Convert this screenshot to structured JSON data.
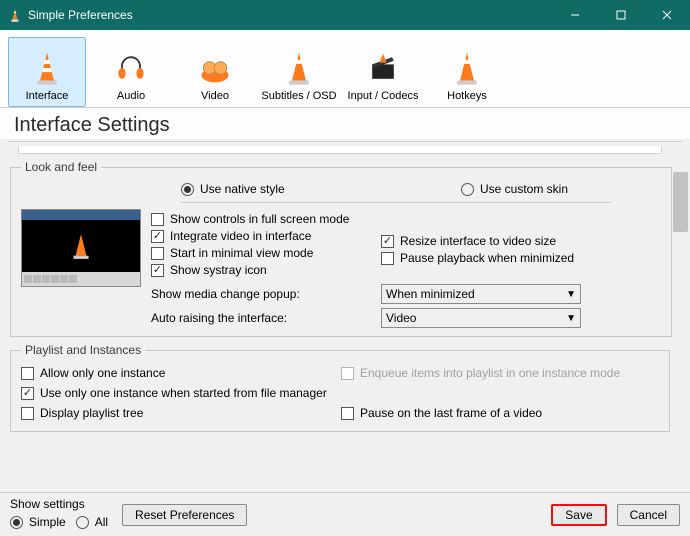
{
  "window": {
    "title": "Simple Preferences"
  },
  "tabs": {
    "interface": "Interface",
    "audio": "Audio",
    "video": "Video",
    "subs": "Subtitles / OSD",
    "input": "Input / Codecs",
    "hotkeys": "Hotkeys"
  },
  "heading": "Interface Settings",
  "look": {
    "legend": "Look and feel",
    "native": "Use native style",
    "skin": "Use custom skin",
    "show_controls": "Show controls in full screen mode",
    "integrate": "Integrate video in interface",
    "resize": "Resize interface to video size",
    "minimal": "Start in minimal view mode",
    "pause_min": "Pause playback when minimized",
    "systray": "Show systray icon",
    "popup_label": "Show media change popup:",
    "popup_value": "When minimized",
    "raise_label": "Auto raising the interface:",
    "raise_value": "Video"
  },
  "playlist": {
    "legend": "Playlist and Instances",
    "one_instance": "Allow only one instance",
    "enqueue": "Enqueue items into playlist in one instance mode",
    "one_fm": "Use only one instance when started from file manager",
    "tree": "Display playlist tree",
    "last_frame": "Pause on the last frame of a video"
  },
  "footer": {
    "show_settings": "Show settings",
    "simple": "Simple",
    "all": "All",
    "reset": "Reset Preferences",
    "save": "Save",
    "cancel": "Cancel"
  }
}
